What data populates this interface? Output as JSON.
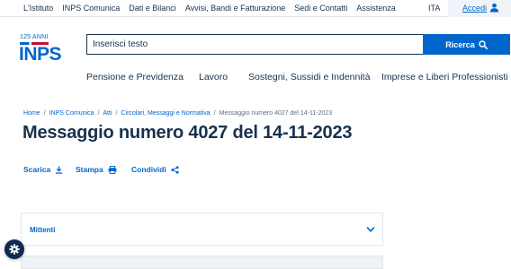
{
  "top_nav": {
    "items": [
      "L'Istituto",
      "INPS Comunica",
      "Dati e Bilanci",
      "Avvisi, Bandi e Fatturazione",
      "Sedi e Contatti",
      "Assistenza"
    ],
    "language": "ITA",
    "login_label": "Accedi"
  },
  "logo": {
    "anniversary_text": "125 ANNI",
    "brand_text": "INPS"
  },
  "search": {
    "placeholder": "Inserisci testo",
    "button_label": "Ricerca"
  },
  "main_nav": {
    "items": [
      "Pensione e Previdenza",
      "Lavoro",
      "Sostegni, Sussidi e Indennità",
      "Imprese e Liberi Professionisti"
    ]
  },
  "breadcrumb": {
    "items": [
      "Home",
      "INPS Comunica",
      "Atti",
      "Circolari, Messaggi e Normativa"
    ],
    "separator": "/",
    "current": "Messaggio numero 4027 del 14-11-2023"
  },
  "page": {
    "title": "Messaggio numero 4027 del 14-11-2023"
  },
  "actions": {
    "download_label": "Scarica",
    "print_label": "Stampa",
    "share_label": "Condividi"
  },
  "accordion": {
    "label": "Mittenti"
  },
  "colors": {
    "primary": "#0066cc",
    "text": "#17324d",
    "fab": "#0f2b50"
  }
}
